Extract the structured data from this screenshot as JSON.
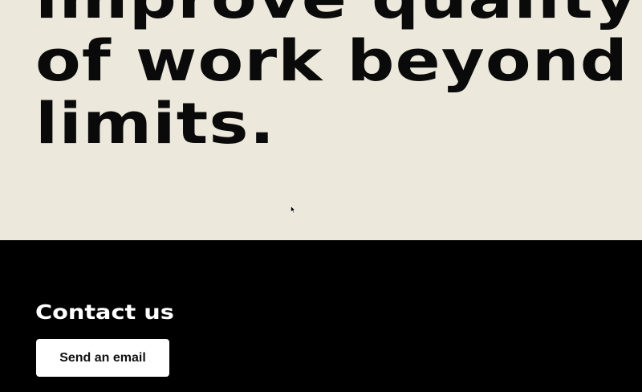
{
  "hero": {
    "headline_lines": [
      "improve quality",
      "of work beyond",
      "limits."
    ]
  },
  "contact": {
    "title": "Contact us",
    "email_button_label": "Send an email"
  },
  "colors": {
    "hero_background": "#ece8dc",
    "headline_text": "#0a0a0a",
    "contact_background": "#000000",
    "button_background": "#ffffff"
  },
  "icons": {
    "cursor": "mouse-pointer-icon"
  }
}
